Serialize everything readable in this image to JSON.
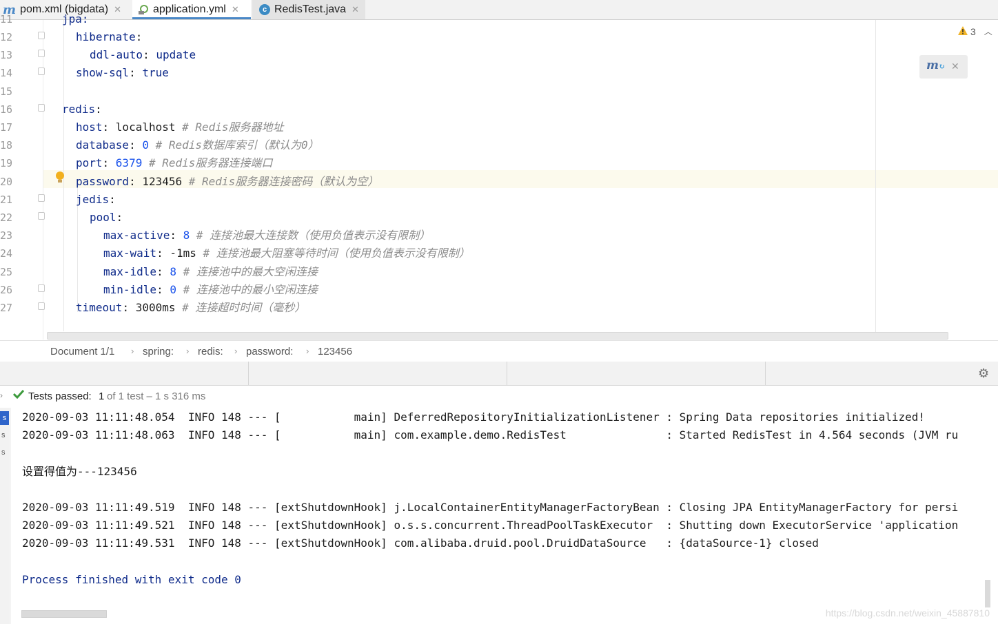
{
  "tabs": [
    {
      "prefix": "m",
      "label": "pom.xml (bigdata)",
      "close": "✕"
    },
    {
      "label": "application.yml",
      "close": "✕"
    },
    {
      "prefix": "c",
      "label": "RedisTest.java",
      "close": "✕"
    }
  ],
  "editor": {
    "warnings_count": "3",
    "lines": [
      {
        "n": "12",
        "key": "hibernate",
        "sep": ":",
        "val": "",
        "comment": ""
      },
      {
        "n": "13",
        "key": "ddl-auto",
        "sep": ": ",
        "val": "update",
        "comment": ""
      },
      {
        "n": "14",
        "key": "show-sql",
        "sep": ": ",
        "val": "true",
        "comment": ""
      },
      {
        "n": "15",
        "key": "",
        "sep": "",
        "val": "",
        "comment": ""
      },
      {
        "n": "16",
        "key": "redis",
        "sep": ":",
        "val": "",
        "comment": ""
      },
      {
        "n": "17",
        "key": "host",
        "sep": ": ",
        "val": "localhost ",
        "comment": "# Redis服务器地址"
      },
      {
        "n": "18",
        "key": "database",
        "sep": ": ",
        "val": "0 ",
        "comment": "# Redis数据库索引（默认为0）"
      },
      {
        "n": "19",
        "key": "port",
        "sep": ": ",
        "val": "6379 ",
        "comment": "# Redis服务器连接端口"
      },
      {
        "n": "20",
        "key": "password",
        "sep": ": ",
        "val": "123456 ",
        "comment": "# Redis服务器连接密码（默认为空）"
      },
      {
        "n": "21",
        "key": "jedis",
        "sep": ":",
        "val": "",
        "comment": ""
      },
      {
        "n": "22",
        "key": "pool",
        "sep": ":",
        "val": "",
        "comment": ""
      },
      {
        "n": "23",
        "key": "max-active",
        "sep": ": ",
        "val": "8 ",
        "comment": "# 连接池最大连接数（使用负值表示没有限制）"
      },
      {
        "n": "24",
        "key": "max-wait",
        "sep": ": ",
        "val": "-1ms ",
        "comment": "# 连接池最大阻塞等待时间（使用负值表示没有限制）"
      },
      {
        "n": "25",
        "key": "max-idle",
        "sep": ": ",
        "val": "8 ",
        "comment": "# 连接池中的最大空闲连接"
      },
      {
        "n": "26",
        "key": "min-idle",
        "sep": ": ",
        "val": "0 ",
        "comment": "# 连接池中的最小空闲连接"
      },
      {
        "n": "27",
        "key": "timeout",
        "sep": ": ",
        "val": "3000ms ",
        "comment": "# 连接超时时间（毫秒）"
      }
    ]
  },
  "breadcrumb": [
    "Document 1/1",
    "spring:",
    "redis:",
    "password:",
    "123456"
  ],
  "run": {
    "status_label": "Tests passed:",
    "status_count": "1",
    "status_rest": "of 1 test – 1 s 316 ms",
    "console": [
      "2020-09-03 11:11:48.054  INFO 148 --- [           main] DeferredRepositoryInitializationListener : Spring Data repositories initialized!",
      "2020-09-03 11:11:48.063  INFO 148 --- [           main] com.example.demo.RedisTest               : Started RedisTest in 4.564 seconds (JVM ru",
      "",
      "设置得值为---123456",
      "",
      "2020-09-03 11:11:49.519  INFO 148 --- [extShutdownHook] j.LocalContainerEntityManagerFactoryBean : Closing JPA EntityManagerFactory for persi",
      "2020-09-03 11:11:49.521  INFO 148 --- [extShutdownHook] o.s.s.concurrent.ThreadPoolTaskExecutor  : Shutting down ExecutorService 'application",
      "2020-09-03 11:11:49.531  INFO 148 --- [extShutdownHook] com.alibaba.druid.pool.DruidDataSource   : {dataSource-1} closed",
      "",
      "Process finished with exit code 0"
    ],
    "side_labels": [
      "s",
      "s",
      "s"
    ]
  },
  "watermark": "https://blog.csdn.net/weixin_45887810"
}
